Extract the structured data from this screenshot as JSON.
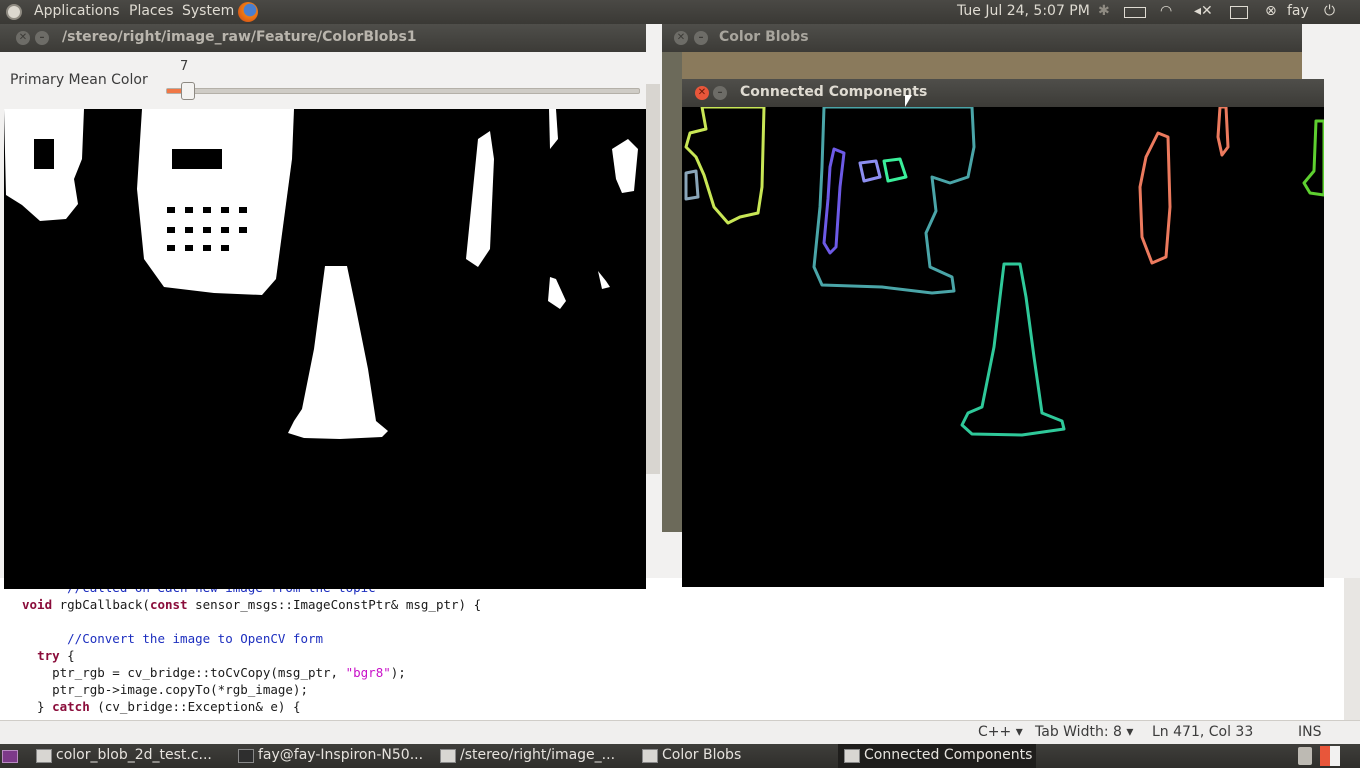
{
  "top_panel": {
    "menus": [
      "Applications",
      "Places",
      "System"
    ],
    "clock": "Tue Jul 24,  5:07 PM",
    "user": "fay"
  },
  "colorblobs1_window": {
    "title": "/stereo/right/image_raw/Feature/ColorBlobs1",
    "slider_label": "Primary Mean Color",
    "slider_value": "7",
    "slider_fraction": 0.007
  },
  "colorblobs_window": {
    "title": "Color Blobs"
  },
  "connected_components_window": {
    "title": "Connected Components"
  },
  "editor": {
    "lines": [
      {
        "parts": [
          {
            "t": "      //called on each new image from the topic",
            "c": "cm"
          }
        ]
      },
      {
        "parts": [
          {
            "t": "void",
            "c": "kw"
          },
          {
            "t": " rgbCallback(",
            "c": ""
          },
          {
            "t": "const",
            "c": "kw"
          },
          {
            "t": " sensor_msgs::ImageConstPtr& msg_ptr) {",
            "c": ""
          }
        ]
      },
      {
        "parts": [
          {
            "t": "",
            "c": ""
          }
        ]
      },
      {
        "parts": [
          {
            "t": "      //Convert the image to OpenCV form",
            "c": "cm"
          }
        ]
      },
      {
        "parts": [
          {
            "t": "  ",
            "c": ""
          },
          {
            "t": "try",
            "c": "kw"
          },
          {
            "t": " {",
            "c": ""
          }
        ]
      },
      {
        "parts": [
          {
            "t": "    ptr_rgb = cv_bridge::toCvCopy(msg_ptr, ",
            "c": ""
          },
          {
            "t": "\"bgr8\"",
            "c": "str"
          },
          {
            "t": ");",
            "c": ""
          }
        ]
      },
      {
        "parts": [
          {
            "t": "    ptr_rgb->image.copyTo(*rgb_image);",
            "c": ""
          }
        ]
      },
      {
        "parts": [
          {
            "t": "  } ",
            "c": ""
          },
          {
            "t": "catch",
            "c": "kw"
          },
          {
            "t": " (cv_bridge::Exception& e) {",
            "c": ""
          }
        ]
      }
    ]
  },
  "statusbar": {
    "language": "C++",
    "tab_width": "Tab Width:  8",
    "position": "Ln 471, Col 33",
    "mode": "INS"
  },
  "taskbar": {
    "items": [
      "color_blob_2d_test.c...",
      "fay@fay-Inspiron-N50...",
      "/stereo/right/image_...",
      "Color Blobs",
      "Connected Components"
    ]
  },
  "colors": {
    "panel_bg": "#3c3b37",
    "close_button": "#e8563a",
    "cone_contour": "#2fc99a"
  }
}
